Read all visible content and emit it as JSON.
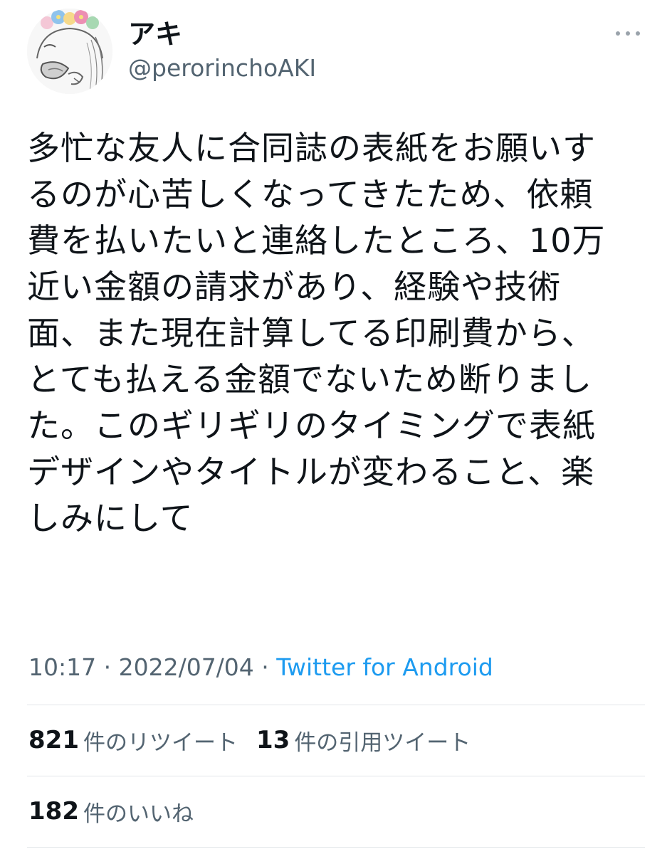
{
  "user": {
    "display_name": "アキ",
    "handle": "@perorinchoAKI"
  },
  "tweet": {
    "text": "多忙な友人に合同誌の表紙をお願いす\nるのが心苦しくなってきたため、依頼\n費を払いたいと連絡したところ、10万\n近い金額の請求があり、経験や技術\n面、また現在計算してる印刷費から、\nとても払える金額でないため断りまし\nた。このギリギリのタイミングで表紙\nデザインやタイトルが変わること、楽\nしみにして",
    "time": "10:17",
    "separator": " · ",
    "date": "2022/07/04",
    "source": "Twitter for Android"
  },
  "stats": {
    "retweets": {
      "count": "821",
      "label": "件のリツイート"
    },
    "quotes": {
      "count": "13",
      "label": "件の引用ツイート"
    },
    "likes": {
      "count": "182",
      "label": "件のいいね"
    }
  },
  "icons": {
    "more": "more-horizontal-icon"
  },
  "colors": {
    "text": "#0f1419",
    "muted": "#536471",
    "link": "#1d9bf0",
    "divider": "#e3e6e9"
  }
}
